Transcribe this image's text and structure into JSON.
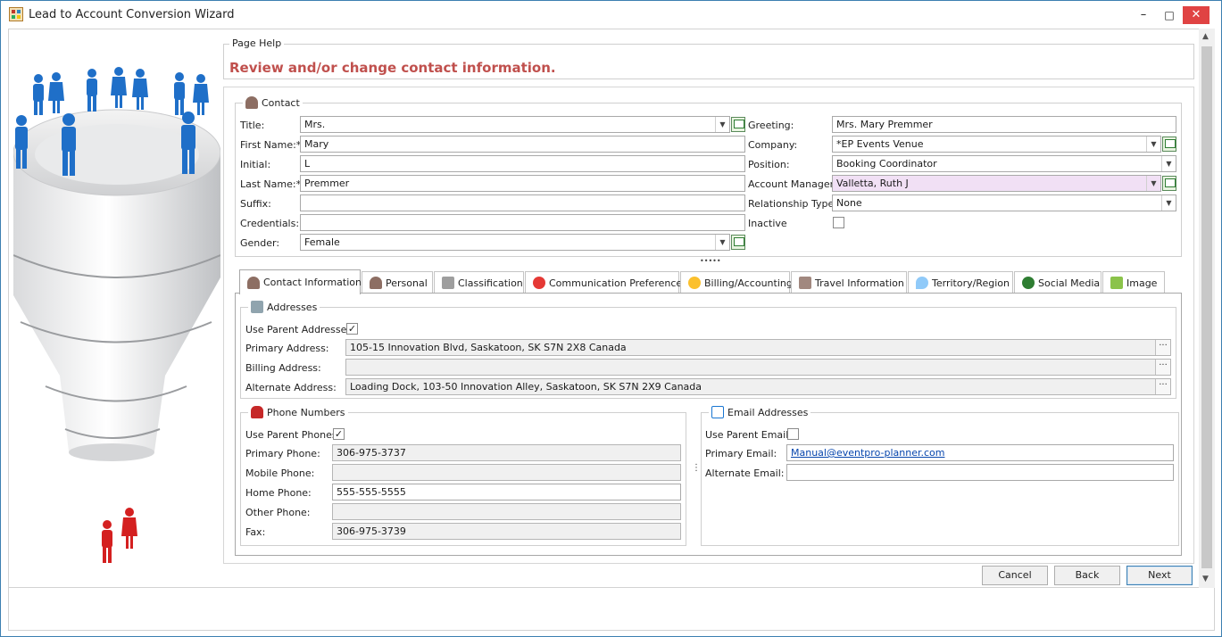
{
  "window": {
    "title": "Lead to Account Conversion Wizard",
    "minimize_glyph": "–",
    "maximize_glyph": "□",
    "close_glyph": "✕"
  },
  "page_help": {
    "legend": "Page Help",
    "text": "Review and/or change contact information."
  },
  "contact": {
    "legend": "Contact",
    "left": {
      "title_label": "Title:",
      "title_value": "Mrs.",
      "first_name_label": "First Name:*",
      "first_name_value": "Mary",
      "initial_label": "Initial:",
      "initial_value": "L",
      "last_name_label": "Last Name:*",
      "last_name_value": "Premmer",
      "suffix_label": "Suffix:",
      "suffix_value": "",
      "credentials_label": "Credentials:",
      "credentials_value": "",
      "gender_label": "Gender:",
      "gender_value": "Female"
    },
    "right": {
      "greeting_label": "Greeting:",
      "greeting_value": "Mrs. Mary Premmer",
      "company_label": "Company:",
      "company_value": "*EP Events Venue",
      "position_label": "Position:",
      "position_value": "Booking Coordinator",
      "account_manager_label": "Account Manager:",
      "account_manager_value": "Valletta, Ruth J",
      "relationship_type_label": "Relationship Type:",
      "relationship_type_value": "None",
      "inactive_label": "Inactive",
      "inactive_checked": false
    }
  },
  "splitter_glyph": "•••••",
  "tabs": [
    {
      "label": "Contact Information",
      "icon": "person-icon",
      "active": true
    },
    {
      "label": "Personal",
      "icon": "person-icon"
    },
    {
      "label": "Classification",
      "icon": "classification-icon"
    },
    {
      "label": "Communication Preferences",
      "icon": "no-contact-icon"
    },
    {
      "label": "Billing/Accounting",
      "icon": "billing-icon"
    },
    {
      "label": "Travel Information",
      "icon": "airplane-icon"
    },
    {
      "label": "Territory/Region",
      "icon": "map-pin-icon"
    },
    {
      "label": "Social Media",
      "icon": "share-icon"
    },
    {
      "label": "Image",
      "icon": "image-icon"
    }
  ],
  "addresses": {
    "legend": "Addresses",
    "use_parent_label": "Use Parent Addresses",
    "use_parent_checked": true,
    "primary_label": "Primary Address:",
    "primary_value": "105-15 Innovation Blvd, Saskatoon, SK S7N 2X8 Canada",
    "billing_label": "Billing Address:",
    "billing_value": "",
    "alternate_label": "Alternate Address:",
    "alternate_value": "Loading Dock, 103-50 Innovation Alley, Saskatoon, SK S7N 2X9 Canada",
    "ellipsis_glyph": "···"
  },
  "phones": {
    "legend": "Phone Numbers",
    "use_parent_label": "Use Parent Phones",
    "use_parent_checked": true,
    "primary_label": "Primary Phone:",
    "primary_value": "306-975-3737",
    "mobile_label": "Mobile Phone:",
    "mobile_value": "",
    "home_label": "Home Phone:",
    "home_value": "555-555-5555",
    "other_label": "Other Phone:",
    "other_value": "",
    "fax_label": "Fax:",
    "fax_value": "306-975-3739"
  },
  "emails": {
    "legend": "Email Addresses",
    "use_parent_label": "Use Parent Emails",
    "use_parent_checked": false,
    "primary_label": "Primary Email:",
    "primary_value": "Manual@eventpro-planner.com",
    "alternate_label": "Alternate Email:",
    "alternate_value": ""
  },
  "buttons": {
    "cancel": "Cancel",
    "back": "Back",
    "next": "Next"
  },
  "check_glyph": "✓",
  "dropdown_glyph": "▼",
  "colors": {
    "window_border": "#3c7fb1",
    "close_button": "#e04343",
    "page_help_text": "#c0504d",
    "account_manager_highlight": "#f1e0f5",
    "people_blue": "#1f6fc8",
    "people_red": "#d42020"
  }
}
